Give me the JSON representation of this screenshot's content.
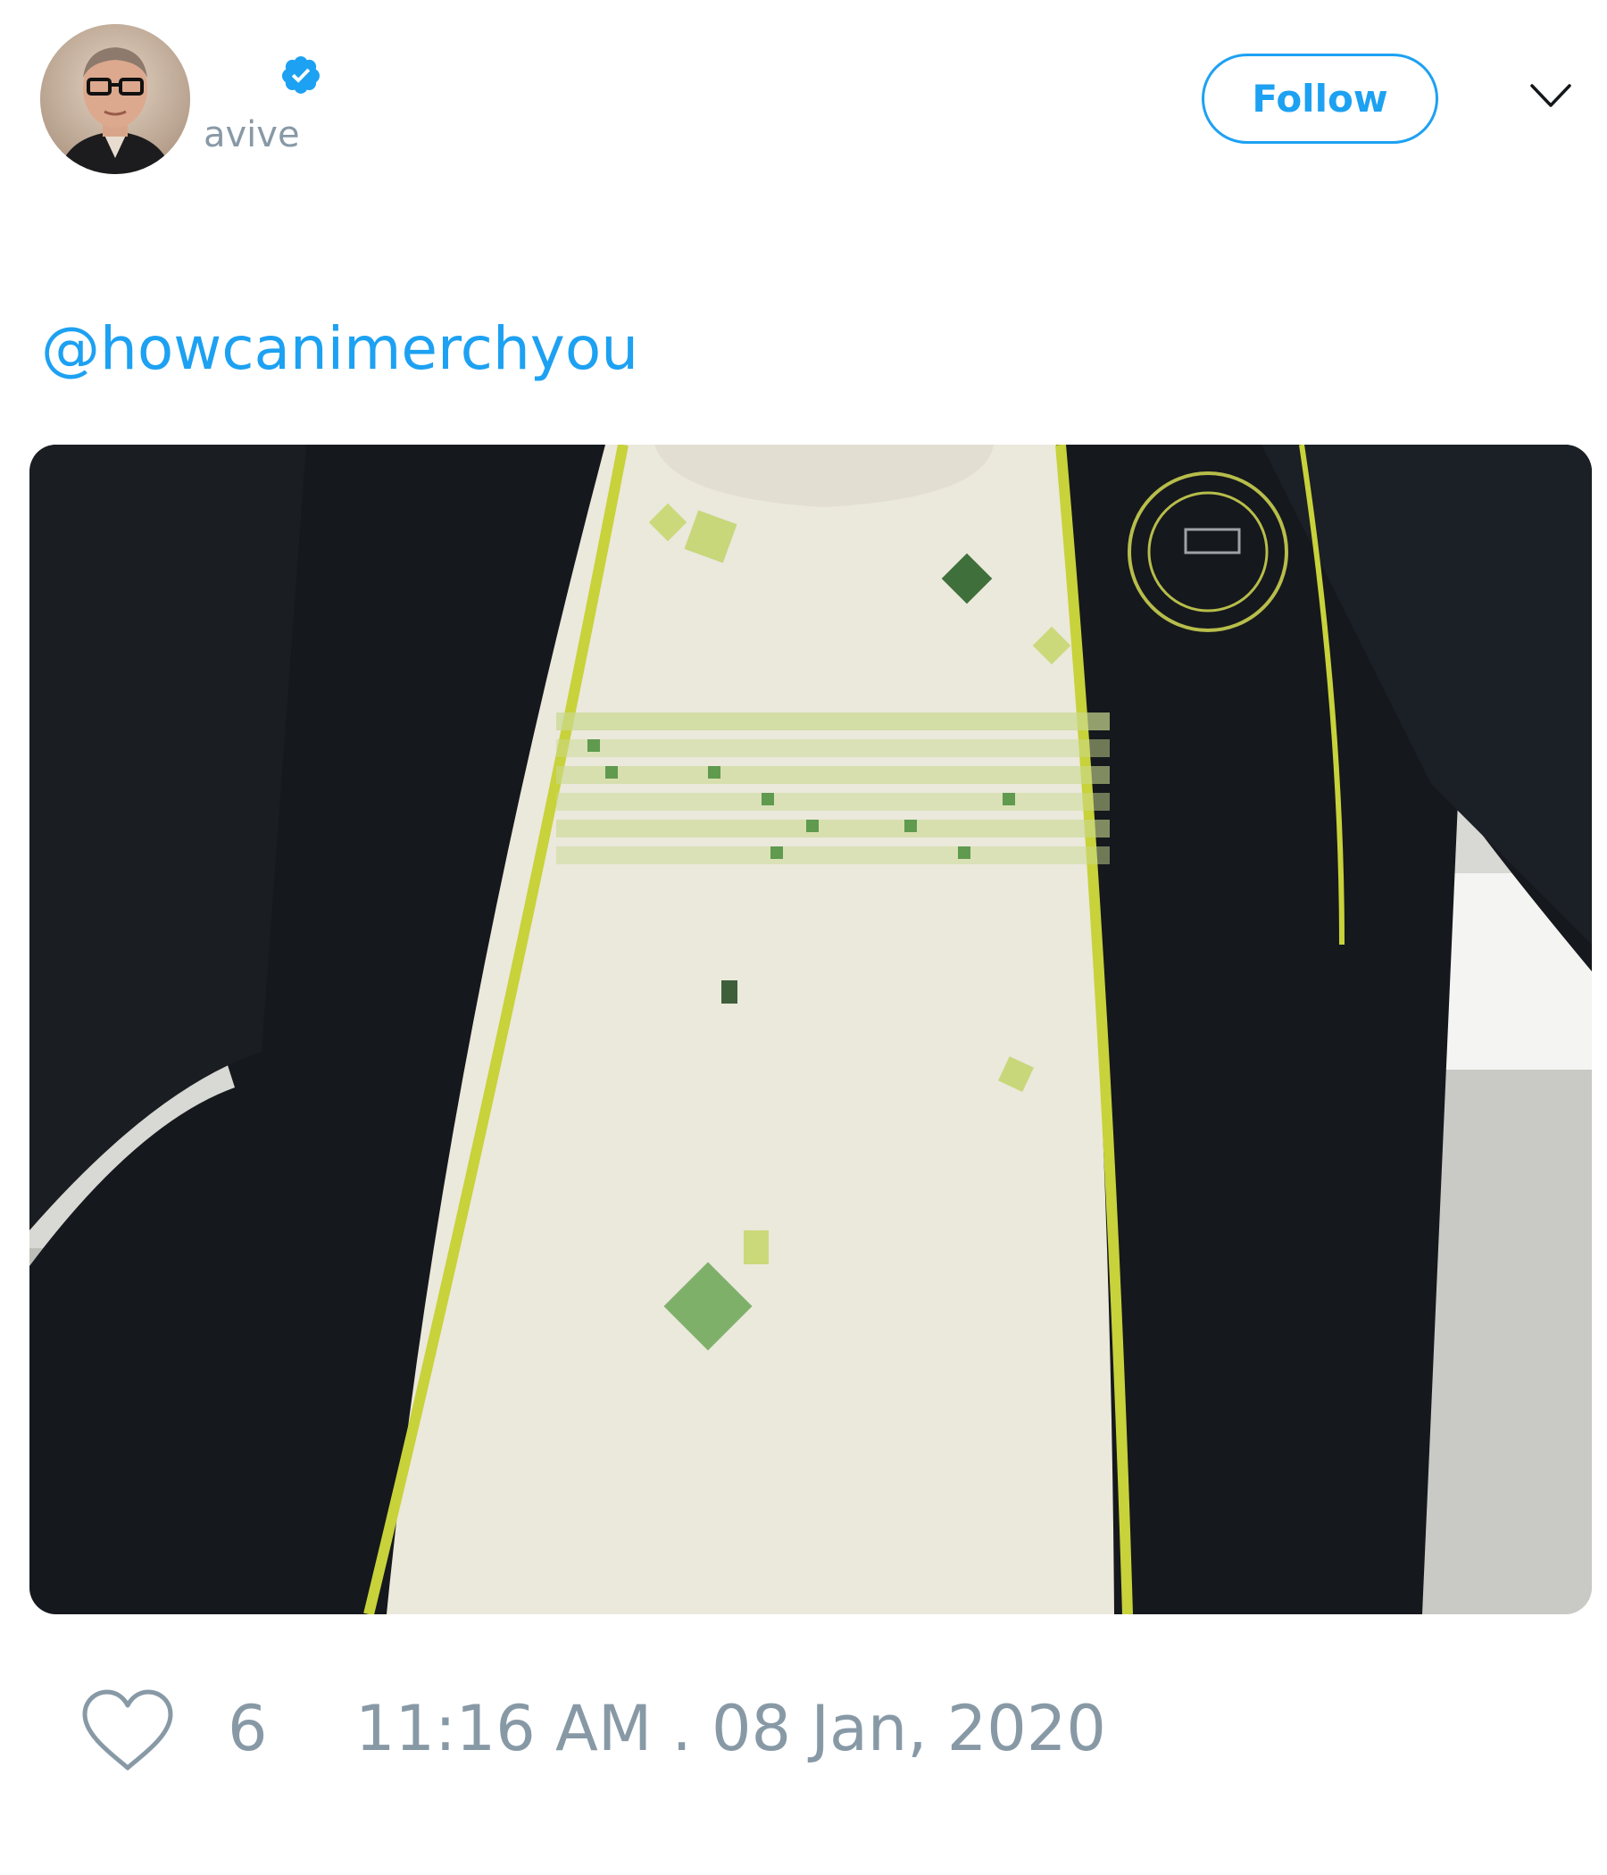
{
  "tweet": {
    "author": {
      "username": "avive",
      "verified": true,
      "avatar_icon": "person-avatar"
    },
    "follow_label": "Follow",
    "menu_icon": "chevron-down-icon",
    "text": "@howcanimerchyou",
    "media": {
      "kind": "photo",
      "subject": "black zip jacket over white t-shirt"
    },
    "like_count": "6",
    "timestamp": "11:16 AM . 08 Jan, 2020"
  },
  "colors": {
    "accent": "#1da1f2",
    "muted": "#8899a6",
    "jacket": "#15181d",
    "shirt": "#ebe8dc",
    "trim": "#c8d23a"
  }
}
